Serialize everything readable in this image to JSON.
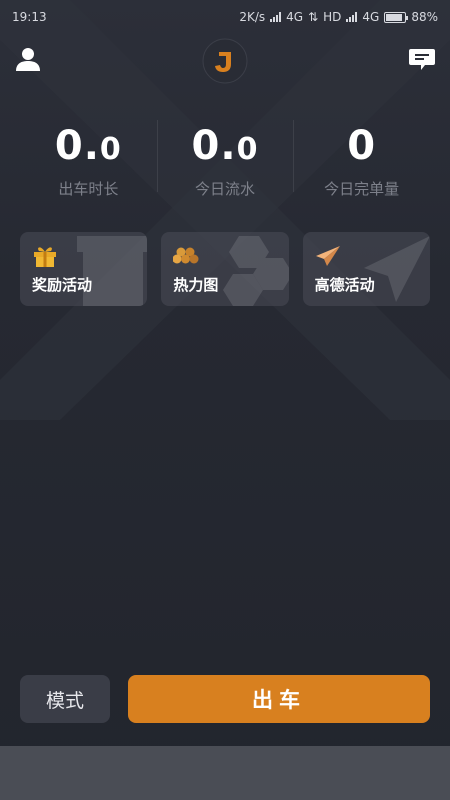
{
  "status_bar": {
    "time": "19:13",
    "network_speed": "2K/s",
    "sim1": "4G",
    "hd": "HD",
    "sim2": "4G",
    "battery_percent": "88%",
    "battery_level": 0.88
  },
  "header": {
    "logo_letter": "J",
    "user_icon": "user-icon",
    "message_icon": "message-icon"
  },
  "stats": [
    {
      "int": "0.",
      "dec": "0",
      "label": "出车时长"
    },
    {
      "int": "0.",
      "dec": "0",
      "label": "今日流水"
    },
    {
      "int": "0",
      "dec": "",
      "label": "今日完单量"
    }
  ],
  "cards": [
    {
      "label": "奖励活动",
      "icon": "gift-icon"
    },
    {
      "label": "热力图",
      "icon": "heatmap-icon"
    },
    {
      "label": "高德活动",
      "icon": "paper-plane-icon"
    }
  ],
  "buttons": {
    "mode": "模式",
    "go": "出车"
  },
  "colors": {
    "accent": "#d8801f",
    "background": "#23262f",
    "card": "#3f424c"
  }
}
